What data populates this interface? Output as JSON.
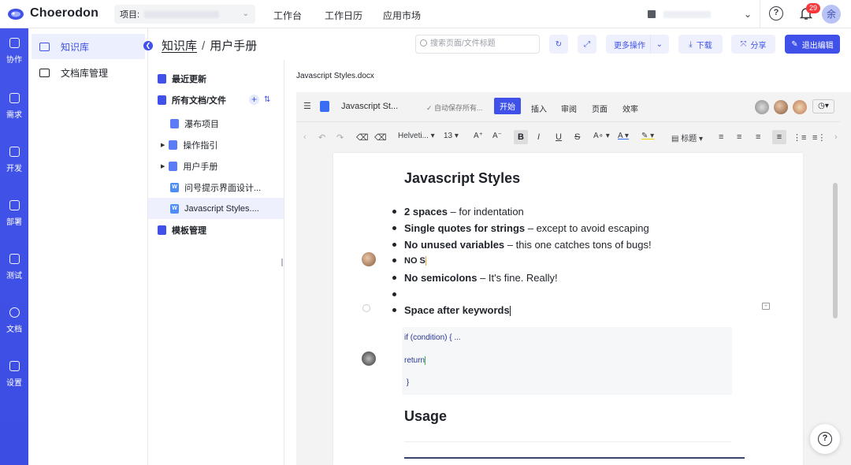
{
  "app": {
    "name": "Choerodon"
  },
  "topbar": {
    "project_label": "项目:",
    "nav": [
      "工作台",
      "工作日历",
      "应用市场"
    ],
    "notification_count": "29",
    "avatar_text": "余"
  },
  "rail": [
    {
      "label": "协作",
      "icon": "collab-icon"
    },
    {
      "label": "需求",
      "icon": "layers-icon"
    },
    {
      "label": "开发",
      "icon": "code-icon"
    },
    {
      "label": "部署",
      "icon": "deploy-icon"
    },
    {
      "label": "测试",
      "icon": "test-icon"
    },
    {
      "label": "文档",
      "icon": "docs-icon"
    },
    {
      "label": "设置",
      "icon": "settings-icon"
    }
  ],
  "sidebar": {
    "items": [
      {
        "label": "知识库",
        "active": true
      },
      {
        "label": "文档库管理",
        "active": false
      }
    ]
  },
  "header": {
    "breadcrumb_root": "知识库",
    "breadcrumb_sep": "/",
    "breadcrumb_current": "用户手册",
    "search_placeholder": "搜索页面/文件标题",
    "more_label": "更多操作",
    "download_label": "下载",
    "share_label": "分享",
    "exit_label": "退出编辑"
  },
  "tree": {
    "recent": "最近更新",
    "all_docs": "所有文档/文件",
    "items": [
      "瀑布项目",
      "操作指引",
      "用户手册",
      "问号提示界面设计...",
      "Javascript Styles...."
    ],
    "templates": "模板管理"
  },
  "editor": {
    "filename": "Javascript Styles.docx",
    "doc_short": "Javascript St...",
    "autosave": "自动保存所有...",
    "tabs": [
      "开始",
      "插入",
      "审阅",
      "页面",
      "效率"
    ],
    "font": "Helveti...",
    "font_size": "13",
    "heading_label": "标题"
  },
  "document": {
    "title": "Javascript Styles",
    "bullets": [
      {
        "bold": "2 spaces",
        "rest": " – for indentation"
      },
      {
        "bold": "Single quotes for strings",
        "rest": " – except to avoid escaping"
      },
      {
        "bold": "No unused variables",
        "rest": " – this one catches tons of bugs!"
      },
      {
        "bold": "NO S",
        "rest": ""
      },
      {
        "bold": "No semicolons",
        "rest": " – It's fine. Really!"
      },
      {
        "bold": "",
        "rest": ""
      },
      {
        "bold": "Space after keywords",
        "rest": ""
      }
    ],
    "code": [
      "if (condition) { ...",
      "return",
      " }"
    ],
    "usage_heading": "Usage"
  },
  "colors": {
    "brand": "#3f51e8",
    "rail": "#4254e9",
    "badge": "#f5383b"
  }
}
